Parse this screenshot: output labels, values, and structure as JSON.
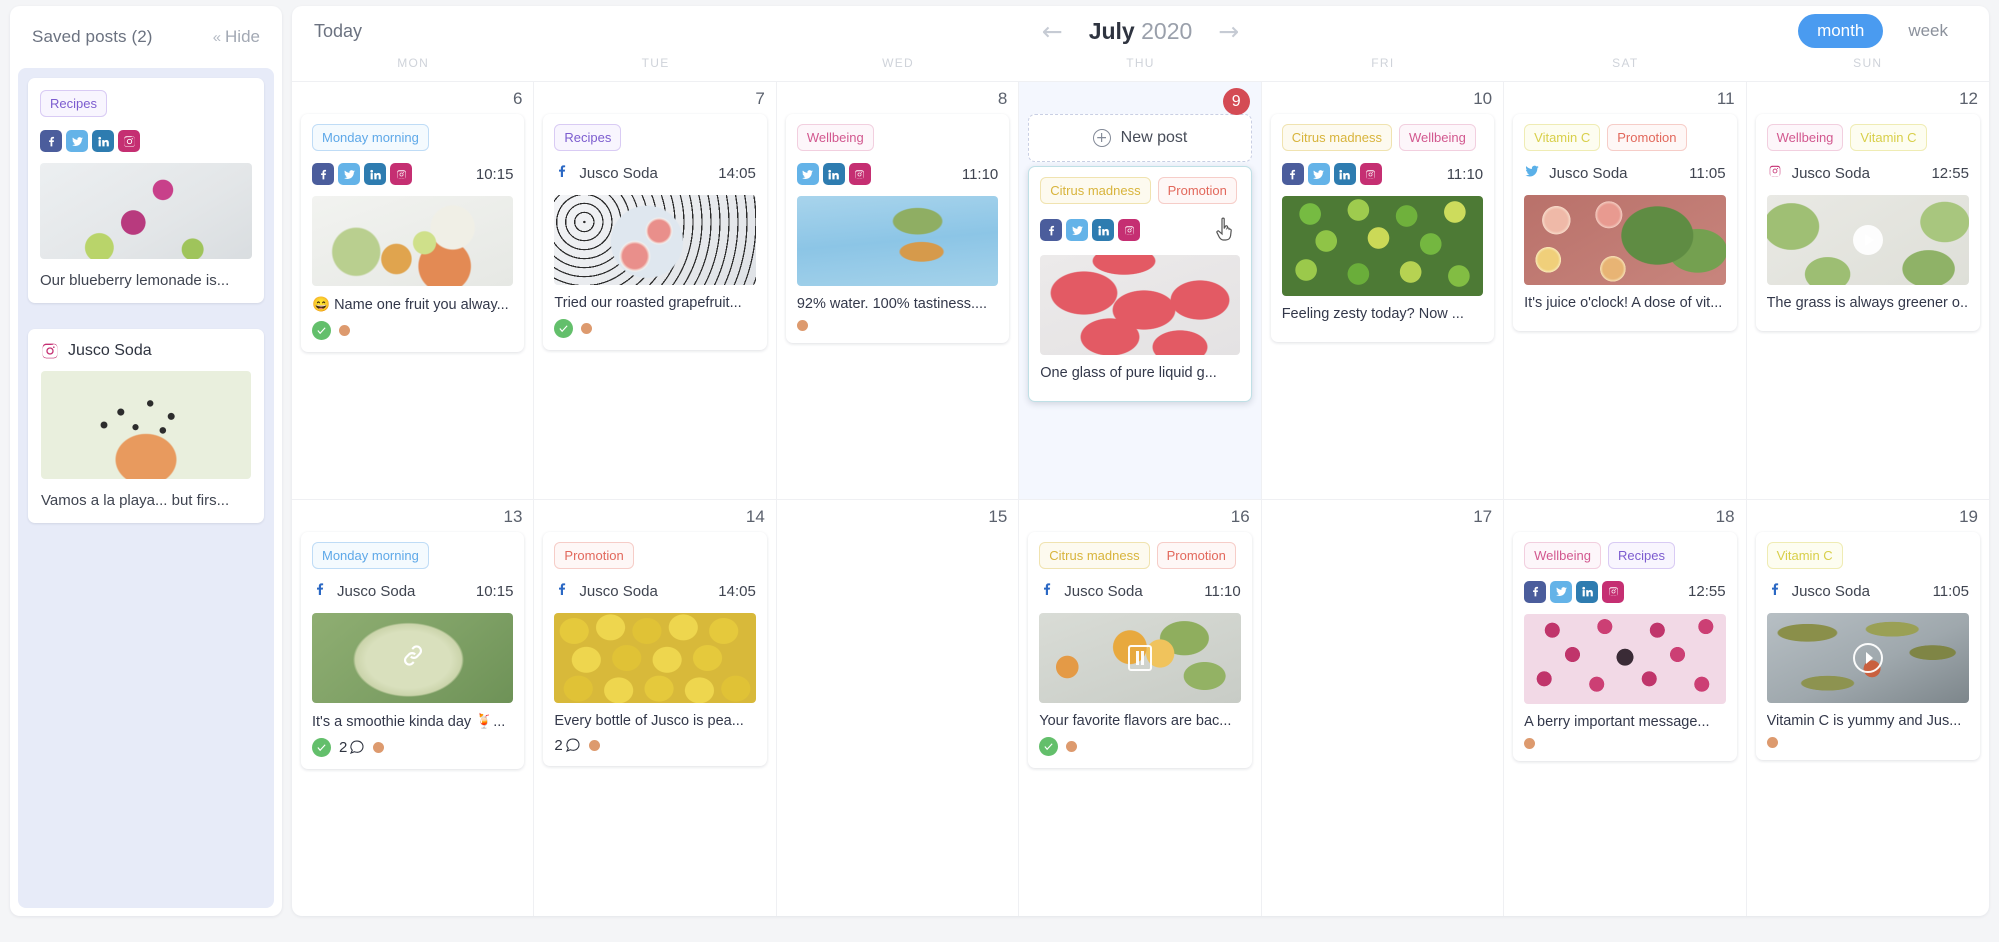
{
  "sidebar": {
    "title": "Saved posts (2)",
    "hide_label": "Hide",
    "saved_posts": [
      {
        "tags": [
          {
            "label": "Recipes",
            "cls": "tag-recipes"
          }
        ],
        "networks": [
          "facebook",
          "twitter",
          "linkedin",
          "instagram"
        ],
        "caption": "Our blueberry lemonade is...",
        "account": "",
        "stacked": true
      },
      {
        "tags": [],
        "networks": [],
        "account": "Jusco Soda",
        "account_network": "instagram",
        "caption": "Vamos a la playa... but firs...",
        "stacked": false
      }
    ]
  },
  "header": {
    "today_label": "Today",
    "prev_icon": "arrow-left-icon",
    "next_icon": "arrow-right-icon",
    "month": "July",
    "year": "2020",
    "views": [
      {
        "label": "month",
        "active": true
      },
      {
        "label": "week",
        "active": false
      }
    ]
  },
  "calendar": {
    "weekdays": [
      "MON",
      "TUE",
      "WED",
      "THU",
      "FRI",
      "SAT",
      "SUN"
    ],
    "new_post_label": "New post",
    "weeks": [
      [
        {
          "day": "6",
          "today": false,
          "posts": [
            {
              "tags": [
                {
                  "label": "Monday morning",
                  "cls": "tag-monday"
                }
              ],
              "networks": [
                "facebook",
                "twitter",
                "linkedin",
                "instagram"
              ],
              "time": "10:15",
              "thumb": "food-flatlay",
              "caption": "😄 Name one fruit you alway...",
              "status": [
                "ok",
                "dot"
              ],
              "stacked": true
            }
          ]
        },
        {
          "day": "7",
          "today": false,
          "posts": [
            {
              "tags": [
                {
                  "label": "Recipes",
                  "cls": "tag-recipes"
                }
              ],
              "account": "Jusco Soda",
              "account_network": "facebook",
              "time": "14:05",
              "thumb": "grapefruit",
              "caption": "Tried our roasted grapefruit...",
              "status": [
                "ok",
                "dot"
              ],
              "stacked": true
            }
          ]
        },
        {
          "day": "8",
          "today": false,
          "posts": [
            {
              "tags": [
                {
                  "label": "Wellbeing",
                  "cls": "tag-wellbeing"
                }
              ],
              "networks": [
                "twitter",
                "linkedin",
                "instagram"
              ],
              "time": "11:10",
              "thumb": "pineapple-pool",
              "caption": "92% water. 100% tastiness....",
              "status": [
                "dot"
              ],
              "stacked": false
            }
          ]
        },
        {
          "day": "9",
          "today": true,
          "new_post": true,
          "posts": [
            {
              "tags": [
                {
                  "label": "Citrus madness",
                  "cls": "tag-citrus"
                },
                {
                  "label": "Promotion",
                  "cls": "tag-promotion"
                }
              ],
              "networks": [
                "facebook",
                "twitter",
                "linkedin",
                "instagram"
              ],
              "time": "",
              "thumb": "watermelon",
              "caption": "One glass of pure liquid g...",
              "status": [],
              "selected": true,
              "cursor": true
            }
          ]
        },
        {
          "day": "10",
          "today": false,
          "posts": [
            {
              "tags": [
                {
                  "label": "Citrus madness",
                  "cls": "tag-citrus"
                },
                {
                  "label": "Wellbeing",
                  "cls": "tag-wellbeing"
                }
              ],
              "networks": [
                "facebook",
                "twitter",
                "linkedin",
                "instagram"
              ],
              "time": "11:10",
              "thumb": "limes",
              "caption": "Feeling zesty today? Now ...",
              "status": [],
              "stacked": true
            }
          ]
        },
        {
          "day": "11",
          "today": false,
          "posts": [
            {
              "tags": [
                {
                  "label": "Vitamin C",
                  "cls": "tag-vitc"
                },
                {
                  "label": "Promotion",
                  "cls": "tag-promotion"
                }
              ],
              "account": "Jusco Soda",
              "account_network": "twitter",
              "time": "11:05",
              "thumb": "citrus-mint",
              "caption": "It's juice o'clock! A dose of vit...",
              "status": [],
              "stacked": true
            }
          ]
        },
        {
          "day": "12",
          "today": false,
          "posts": [
            {
              "tags": [
                {
                  "label": "Wellbeing",
                  "cls": "tag-wellbeing"
                },
                {
                  "label": "Vitamin C",
                  "cls": "tag-vitc"
                }
              ],
              "account": "Jusco Soda",
              "account_network": "instagram",
              "time": "12:55",
              "thumb": "cucumber-video",
              "overlay": "play",
              "caption": "The grass is always greener o...",
              "status": [],
              "stacked": false
            }
          ]
        }
      ],
      [
        {
          "day": "13",
          "today": false,
          "posts": [
            {
              "tags": [
                {
                  "label": "Monday morning",
                  "cls": "tag-monday"
                }
              ],
              "account": "Jusco Soda",
              "account_network": "facebook",
              "time": "10:15",
              "thumb": "melon",
              "overlay": "link",
              "caption": "It's a smoothie kinda day 🍹...",
              "status": [
                "ok",
                "comments",
                "dot"
              ],
              "comments": "2",
              "stacked": false
            }
          ]
        },
        {
          "day": "14",
          "today": false,
          "posts": [
            {
              "tags": [
                {
                  "label": "Promotion",
                  "cls": "tag-promotion"
                }
              ],
              "account": "Jusco Soda",
              "account_network": "facebook",
              "time": "14:05",
              "thumb": "pears",
              "caption": "Every bottle of Jusco is pea...",
              "status": [
                "comments",
                "dot"
              ],
              "comments": "2",
              "stacked": false
            }
          ]
        },
        {
          "day": "15",
          "today": false,
          "posts": []
        },
        {
          "day": "16",
          "today": false,
          "posts": [
            {
              "tags": [
                {
                  "label": "Citrus madness",
                  "cls": "tag-citrus"
                },
                {
                  "label": "Promotion",
                  "cls": "tag-promotion"
                }
              ],
              "account": "Jusco Soda",
              "account_network": "facebook",
              "time": "11:10",
              "thumb": "oranges",
              "overlay": "carousel",
              "caption": "Your favorite flavors are bac...",
              "status": [
                "ok",
                "dot"
              ],
              "stacked": false
            }
          ]
        },
        {
          "day": "17",
          "today": false,
          "posts": []
        },
        {
          "day": "18",
          "today": false,
          "posts": [
            {
              "tags": [
                {
                  "label": "Wellbeing",
                  "cls": "tag-wellbeing"
                },
                {
                  "label": "Recipes",
                  "cls": "tag-recipes"
                }
              ],
              "networks": [
                "facebook",
                "twitter",
                "linkedin",
                "instagram"
              ],
              "time": "12:55",
              "thumb": "raspberries",
              "caption": "A berry important message...",
              "status": [
                "dot"
              ],
              "stacked": true
            }
          ]
        },
        {
          "day": "19",
          "today": false,
          "posts": [
            {
              "tags": [
                {
                  "label": "Vitamin C",
                  "cls": "tag-vitc"
                }
              ],
              "account": "Jusco Soda",
              "account_network": "facebook",
              "time": "11:05",
              "thumb": "tree-video",
              "overlay": "play-outline",
              "caption": "Vitamin C is yummy and Jus...",
              "status": [
                "dot"
              ],
              "stacked": false
            }
          ]
        }
      ]
    ]
  },
  "colors": {
    "accent": "#4a9bf0",
    "today_badge": "#d44b54",
    "today_column": "#f4f7fe",
    "sidebar_body": "#e7ebf8",
    "status_ok": "#63bf6b",
    "status_pending": "#dd9a6e"
  }
}
